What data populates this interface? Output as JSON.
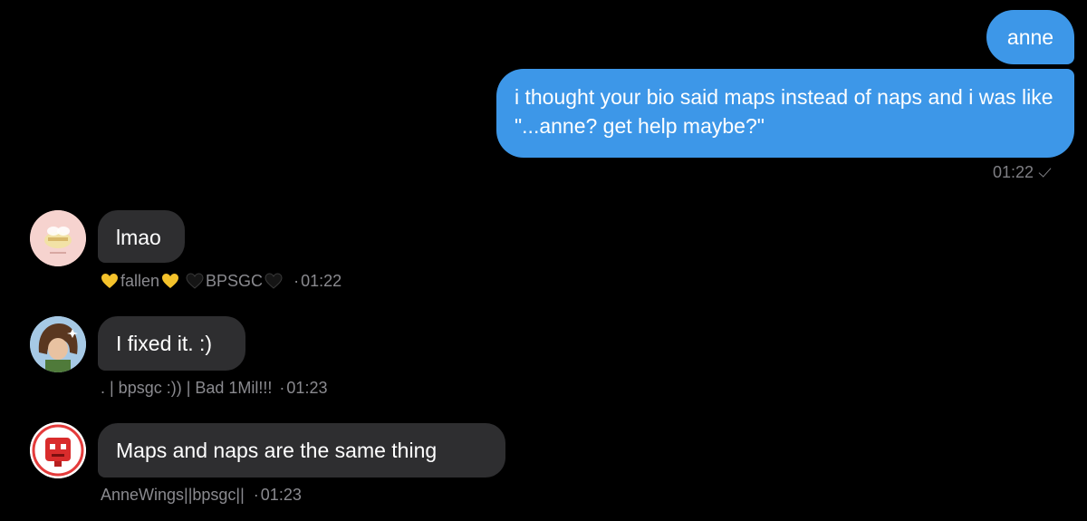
{
  "colors": {
    "background": "#000000",
    "outgoing_bubble": "#3d97e8",
    "incoming_bubble": "#2e2e30",
    "meta_text": "#8a8a8f"
  },
  "outgoing": {
    "messages": [
      {
        "text": "anne"
      },
      {
        "text": "i thought your bio said maps instead of naps and i was like \"...anne? get help maybe?\""
      }
    ],
    "time": "01:22",
    "status_icon": "check-icon"
  },
  "incoming": [
    {
      "text": "lmao",
      "sender": "fallen",
      "sender_group": "BPSGC",
      "time": "01:22",
      "avatar_icon": "bee-sticker-avatar"
    },
    {
      "text": "I fixed it. :)",
      "sender": ". | bpsgc :)) | Bad 1Mil!!!",
      "time": "01:23",
      "avatar_icon": "brown-hair-character-avatar"
    },
    {
      "text": "Maps and naps are the same thing",
      "sender": "AnneWings||bpsgc||",
      "time": "01:23",
      "avatar_icon": "red-robot-avatar"
    }
  ],
  "dot_separator": "·"
}
